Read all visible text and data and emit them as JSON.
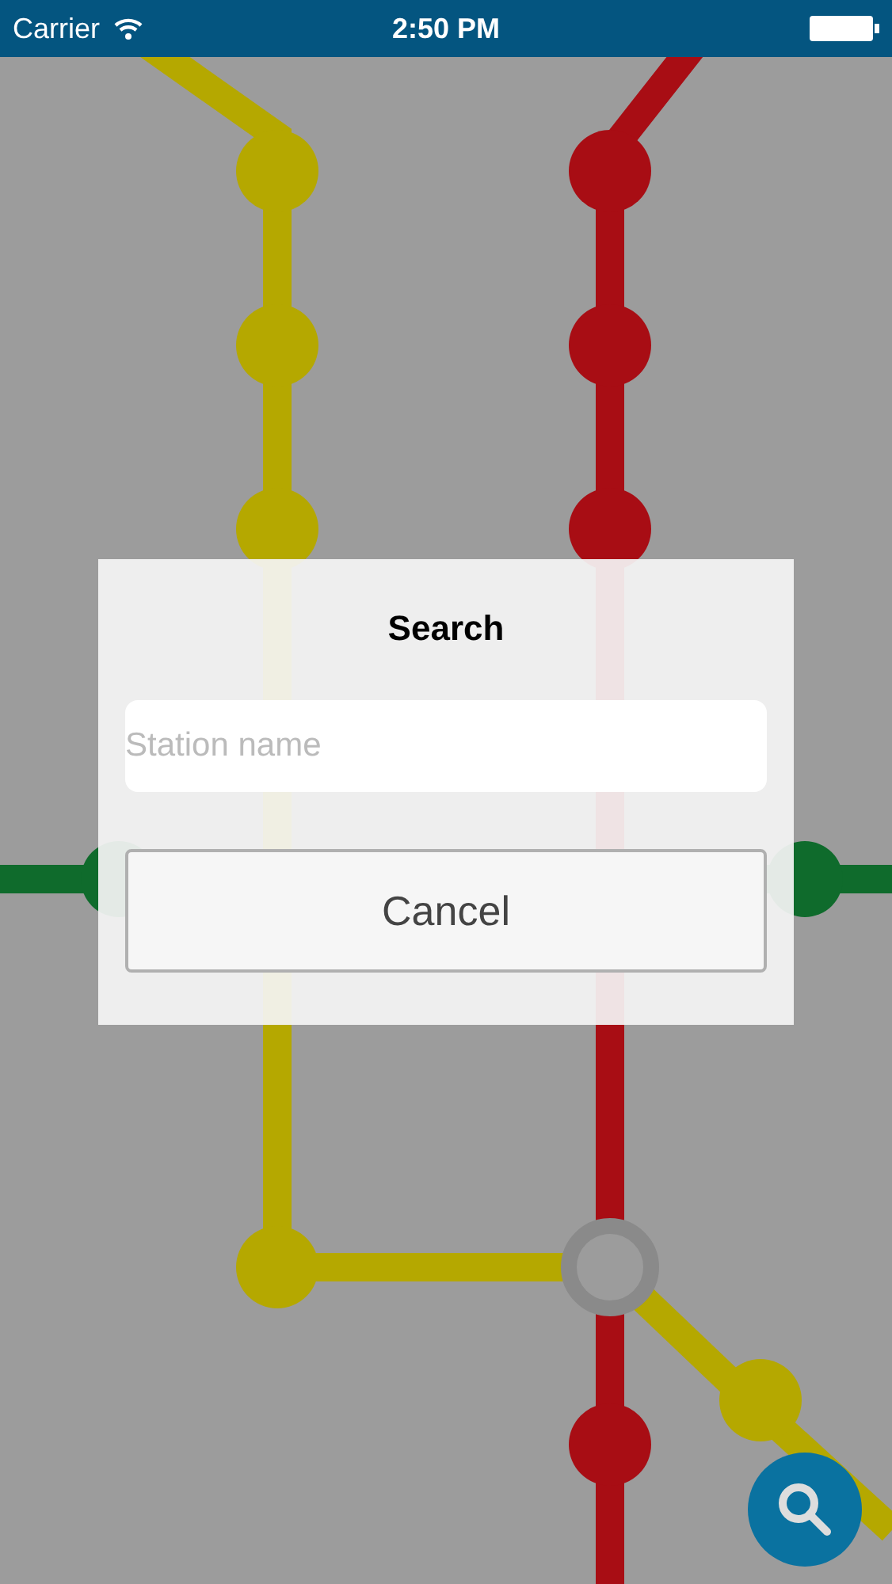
{
  "status_bar": {
    "carrier": "Carrier",
    "time": "2:50 PM"
  },
  "dialog": {
    "title": "Search",
    "search": {
      "placeholder": "Station name"
    },
    "buttons": [
      "Cancel"
    ]
  }
}
